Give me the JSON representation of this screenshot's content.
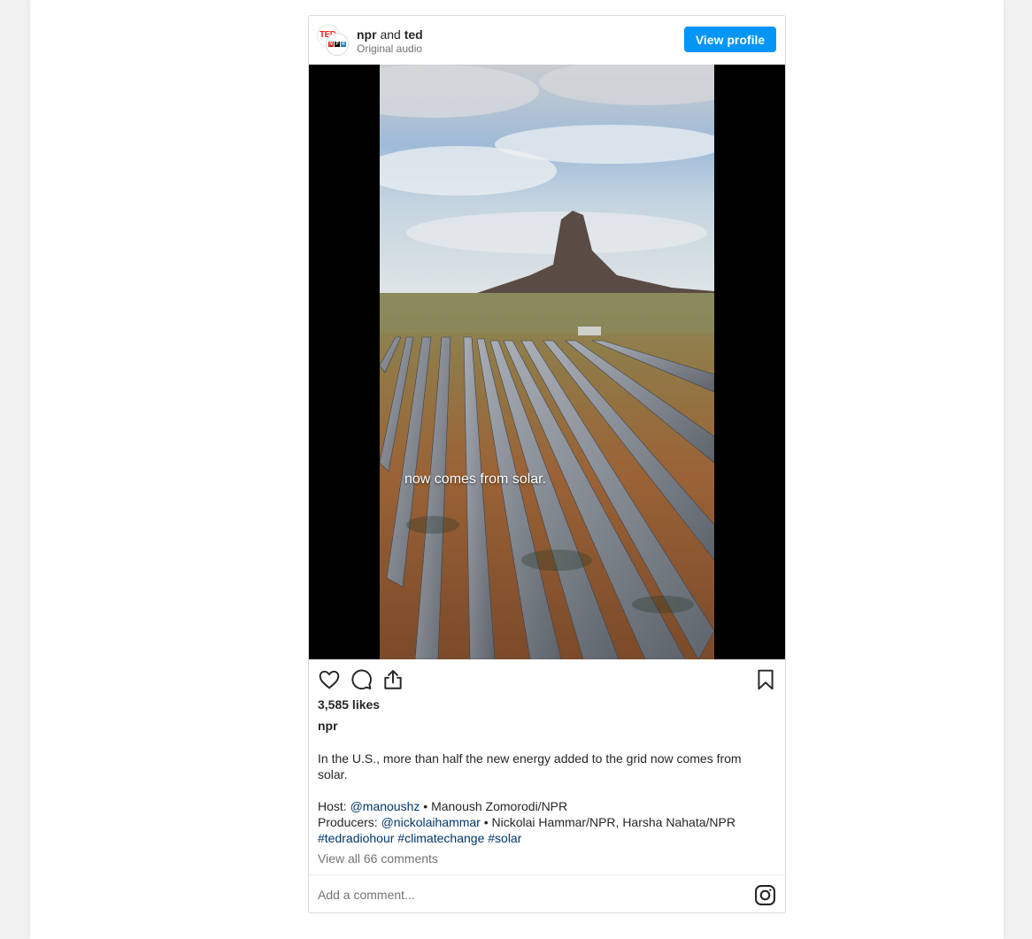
{
  "post": {
    "header": {
      "author_primary": "npr",
      "connector": "and",
      "author_secondary": "ted",
      "subtitle": "Original audio",
      "view_profile_label": "View profile",
      "avatar_primary_text": "TED",
      "avatar_secondary_letters": [
        "N",
        "P",
        "R"
      ]
    },
    "media": {
      "caption_overlay": "now comes from solar."
    },
    "actions": {
      "like_icon": "heart-icon",
      "comment_icon": "comment-icon",
      "share_icon": "share-icon",
      "save_icon": "bookmark-icon"
    },
    "likes": "3,585 likes",
    "author": "npr",
    "description": "In the U.S., more than half the new energy added to the grid now comes from solar.",
    "credits": {
      "host_label": "Host:",
      "host_handle": "@manoushz",
      "host_name": " • Manoush Zomorodi/NPR",
      "producers_label": "Producers:",
      "producers_handle": "@nickolaihammar",
      "producers_names": " • Nickolai Hammar/NPR, Harsha Nahata/NPR",
      "hashtags": [
        "#tedradiohour",
        "#climatechange",
        "#solar"
      ]
    },
    "view_comments": "View all 66 comments",
    "comment_placeholder": "Add a comment..."
  },
  "colors": {
    "accent": "#0095f6",
    "link": "#00376b",
    "ted_red": "#e62b1e",
    "npr_red": "#d62021",
    "npr_black": "#000000",
    "npr_blue": "#237bbd"
  }
}
